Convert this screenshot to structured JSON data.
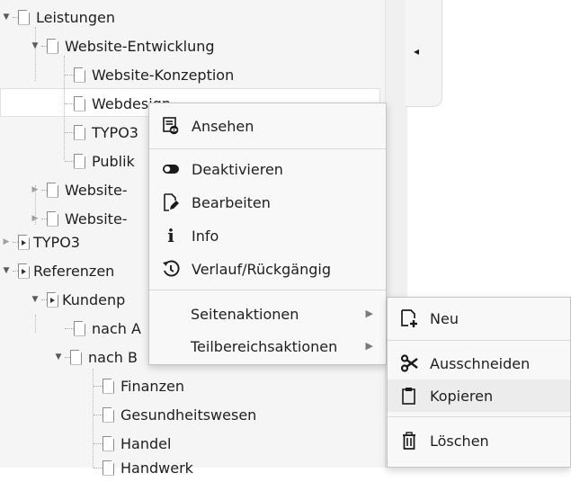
{
  "tree": {
    "items": [
      {
        "label": "Leistungen"
      },
      {
        "label": "Website-Entwicklung"
      },
      {
        "label": "Website-Konzeption"
      },
      {
        "label": "Webdesign"
      },
      {
        "label": "TYPO3"
      },
      {
        "label": "Publik"
      },
      {
        "label": "Website-"
      },
      {
        "label": "Website-"
      },
      {
        "label": "TYPO3"
      },
      {
        "label": "Referenzen"
      },
      {
        "label": "Kundenp"
      },
      {
        "label": "nach A"
      },
      {
        "label": "nach B"
      },
      {
        "label": "Finanzen"
      },
      {
        "label": "Gesundheitswesen"
      },
      {
        "label": "Handel"
      },
      {
        "label": "Handwerk"
      }
    ]
  },
  "context_menu": {
    "items": [
      {
        "label": "Ansehen",
        "icon": "view-icon"
      },
      {
        "label": "Deaktivieren",
        "icon": "toggle-icon"
      },
      {
        "label": "Bearbeiten",
        "icon": "edit-icon"
      },
      {
        "label": "Info",
        "icon": "info-icon"
      },
      {
        "label": "Verlauf/Rückgängig",
        "icon": "history-icon"
      },
      {
        "label": "Seitenaktionen"
      },
      {
        "label": "Teilbereichsaktionen"
      }
    ]
  },
  "submenu": {
    "items": [
      {
        "label": "Neu",
        "icon": "new-page-icon"
      },
      {
        "label": "Ausschneiden",
        "icon": "scissors-icon"
      },
      {
        "label": "Kopieren",
        "icon": "clipboard-icon"
      },
      {
        "label": "Löschen",
        "icon": "trash-icon"
      }
    ]
  },
  "colors": {
    "accent": "#0078e6",
    "menu_bg": "#f8f8f8",
    "tree_bg": "#f5f5f5"
  }
}
